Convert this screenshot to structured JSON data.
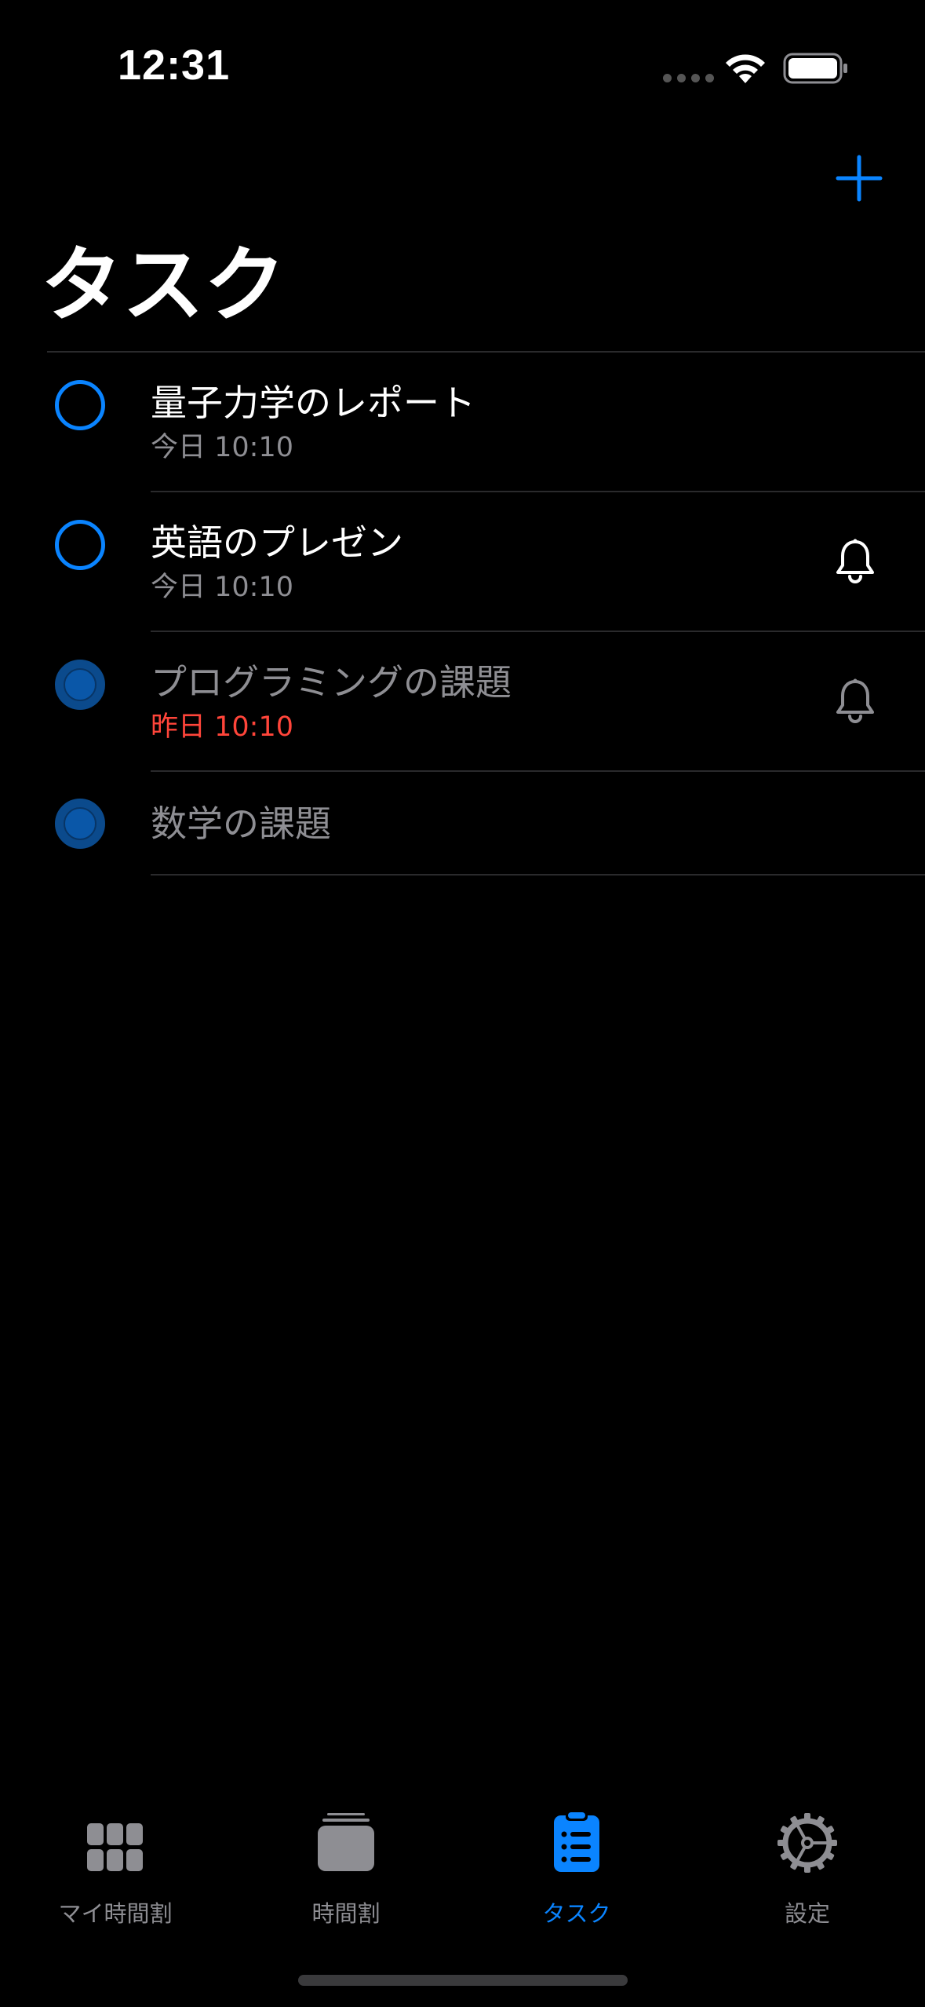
{
  "status_bar": {
    "time": "12:31"
  },
  "header": {
    "title": "タスク",
    "add_icon": "plus-icon"
  },
  "tasks": [
    {
      "title": "量子力学のレポート",
      "due": "今日 10:10",
      "completed": false,
      "reminder": false,
      "overdue": false
    },
    {
      "title": "英語のプレゼン",
      "due": "今日 10:10",
      "completed": false,
      "reminder": true,
      "overdue": false
    },
    {
      "title": "プログラミングの課題",
      "due": "昨日 10:10",
      "completed": true,
      "reminder": true,
      "overdue": true
    },
    {
      "title": "数学の課題",
      "due": "",
      "completed": true,
      "reminder": false,
      "overdue": false
    }
  ],
  "tab_bar": {
    "tabs": [
      {
        "label": "マイ時間割",
        "icon": "grid-icon",
        "active": false
      },
      {
        "label": "時間割",
        "icon": "stack-icon",
        "active": false
      },
      {
        "label": "タスク",
        "icon": "clipboard-list-icon",
        "active": true
      },
      {
        "label": "設定",
        "icon": "gear-icon",
        "active": false
      }
    ]
  },
  "colors": {
    "accent": "#0a84ff",
    "overdue": "#ff453a",
    "secondary_text": "#8e8e93",
    "background": "#000000"
  }
}
